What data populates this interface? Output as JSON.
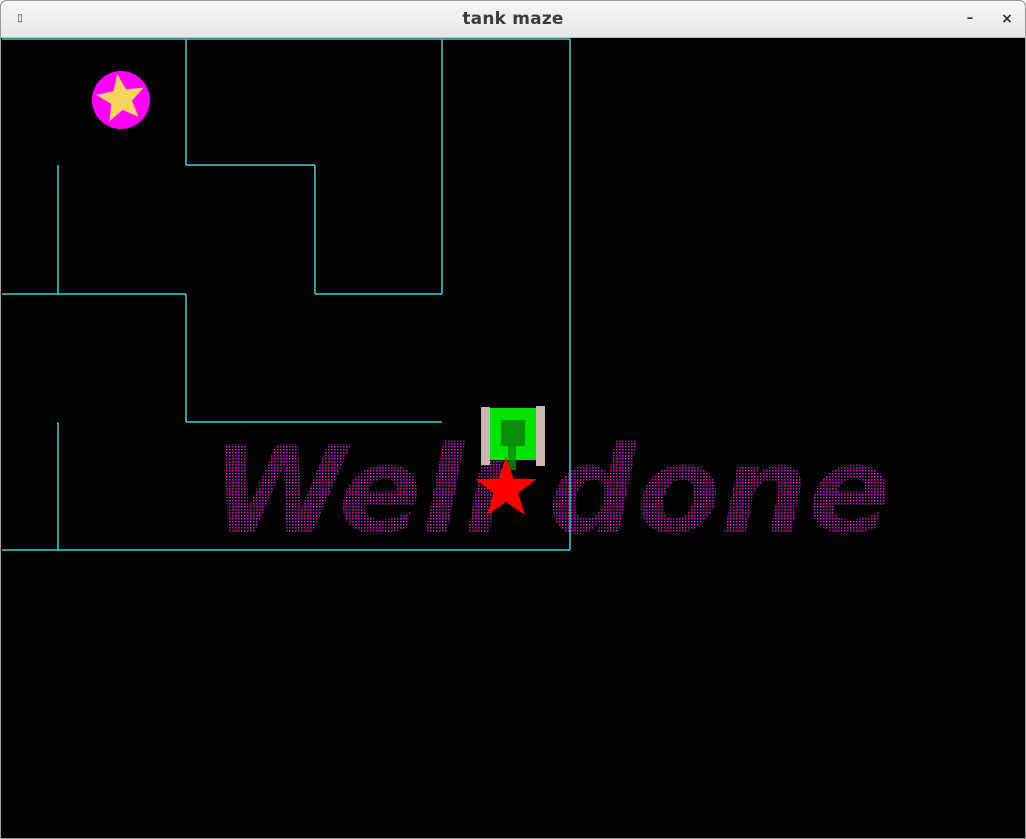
{
  "window": {
    "title": "tank maze",
    "menu_icon": "window-menu-icon",
    "minimize_glyph": "–",
    "close_glyph": "×"
  },
  "game": {
    "message": "Well done",
    "colors": {
      "background": "#000000",
      "maze_wall": "#3fd0d6",
      "message": "#c21bc2",
      "goal_circle": "#ff00ff",
      "goal_star": "#f4d35e",
      "player_tank_body": "#00e400",
      "player_tank_turret": "#0a8f0a",
      "player_tank_tracks": "#c8b8b0",
      "marker_star": "#ff0000"
    },
    "icons": {
      "goal": "star-in-circle-icon",
      "player": "tank-icon",
      "marker": "red-star-icon"
    }
  }
}
